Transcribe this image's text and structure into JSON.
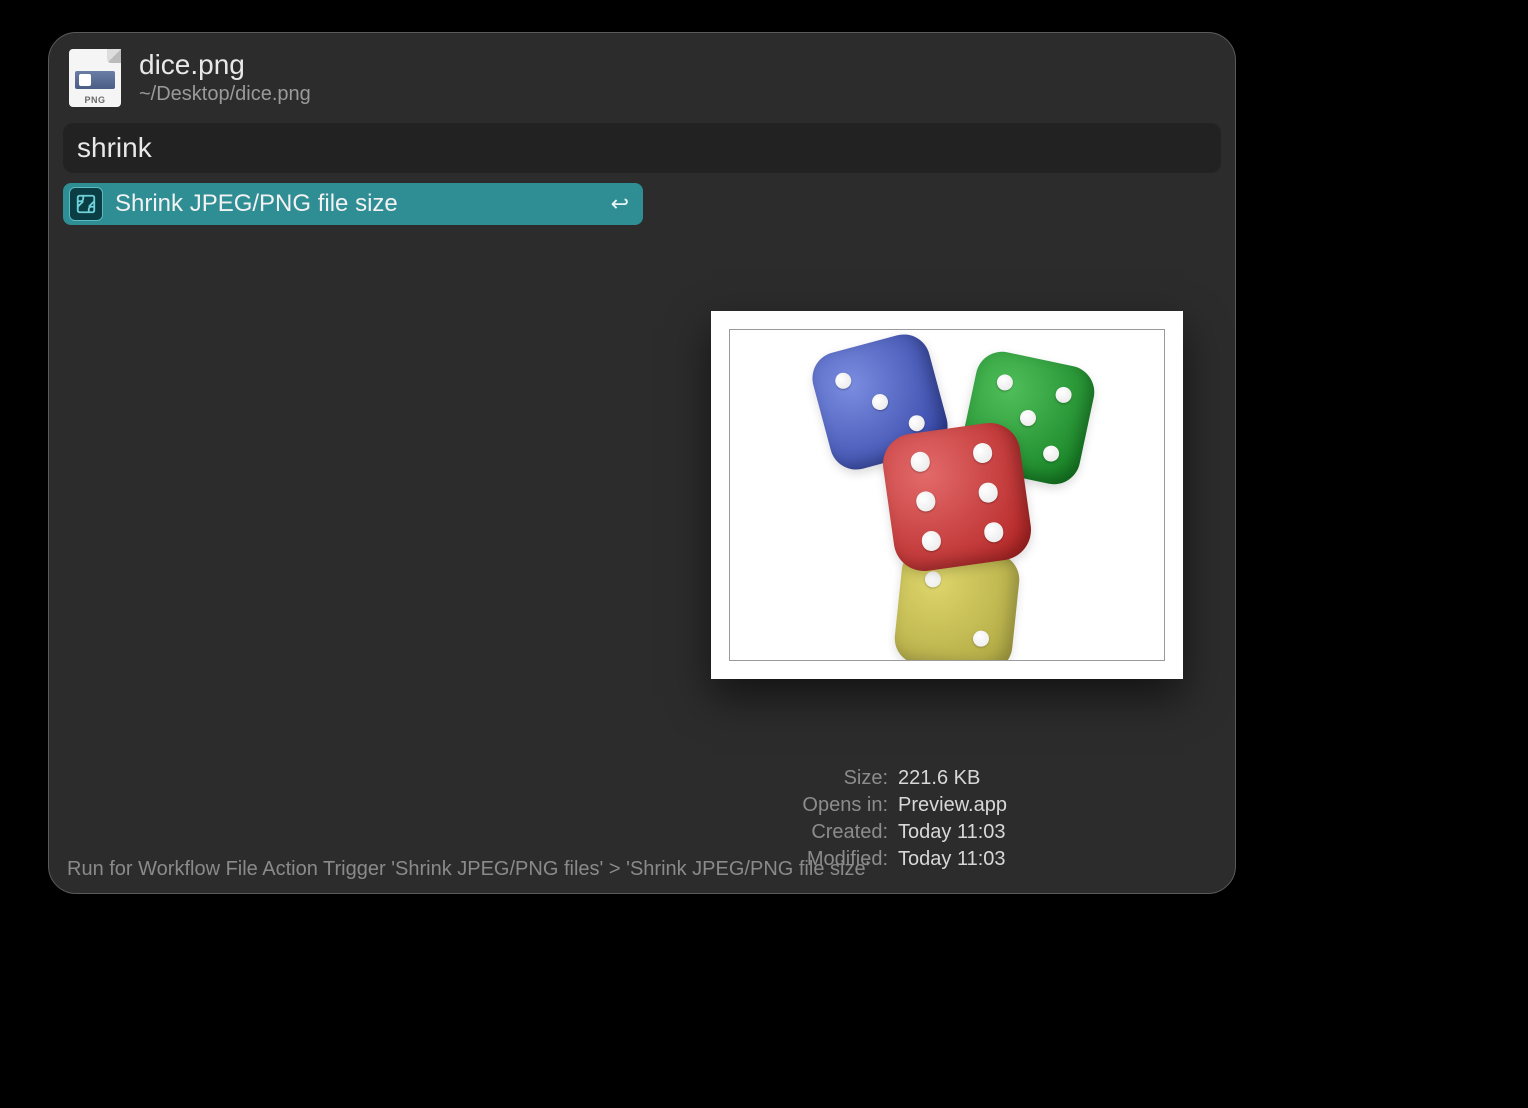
{
  "file": {
    "name": "dice.png",
    "path": "~/Desktop/dice.png",
    "icon_tag": "PNG"
  },
  "search": {
    "value": "shrink"
  },
  "result": {
    "label": "Shrink JPEG/PNG file size"
  },
  "meta": {
    "size_label": "Size:",
    "size_value": "221.6 KB",
    "opens_label": "Opens in:",
    "opens_value": "Preview.app",
    "created_label": "Created:",
    "created_value": "Today 11:03",
    "modified_label": "Modified:",
    "modified_value": "Today 11:03"
  },
  "footer": "Run for Workflow File Action Trigger 'Shrink JPEG/PNG files' > 'Shrink JPEG/PNG file size'"
}
